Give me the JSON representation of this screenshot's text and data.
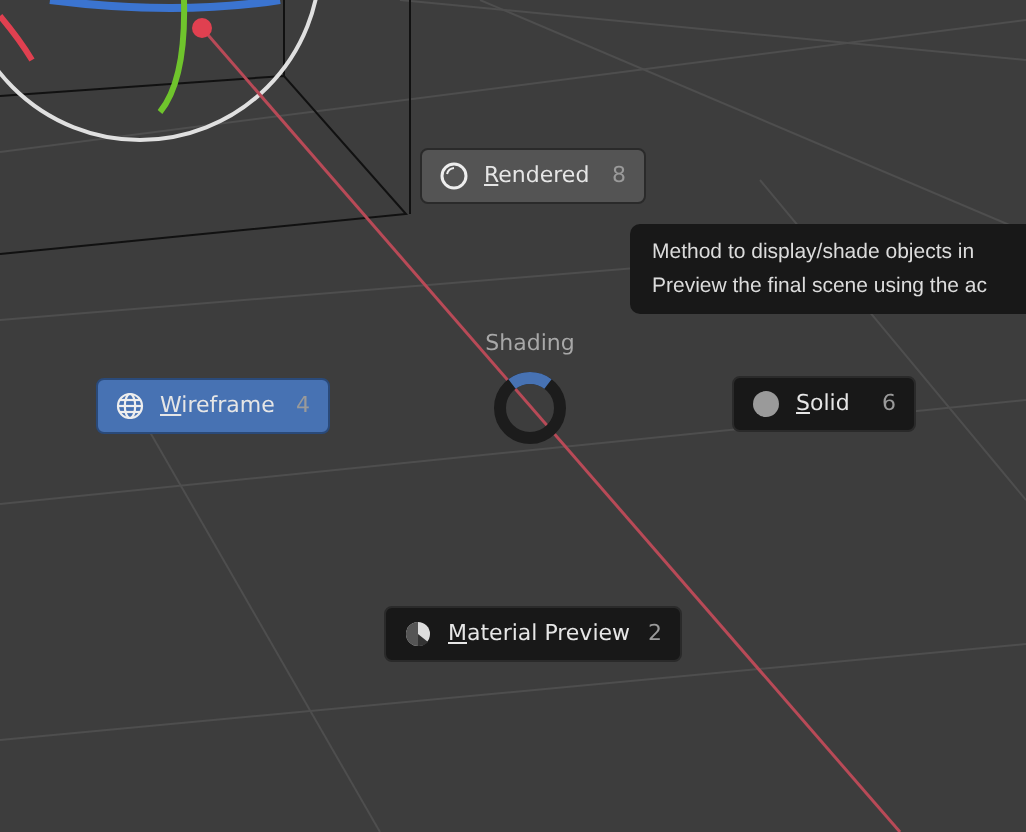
{
  "pie_menu": {
    "title": "Shading",
    "items": [
      {
        "kind": "rendered",
        "label": "Rendered",
        "shortcut": "8",
        "selected": false,
        "hovered": true
      },
      {
        "kind": "wireframe",
        "label": "Wireframe",
        "shortcut": "4",
        "selected": true,
        "hovered": false
      },
      {
        "kind": "solid",
        "label": "Solid",
        "shortcut": "6",
        "selected": false,
        "hovered": false
      },
      {
        "kind": "material",
        "label": "Material Preview",
        "shortcut": "2",
        "selected": false,
        "hovered": false
      }
    ]
  },
  "tooltip": {
    "lines": [
      "Method to display/shade objects in",
      "Preview the final scene using the ac"
    ]
  }
}
